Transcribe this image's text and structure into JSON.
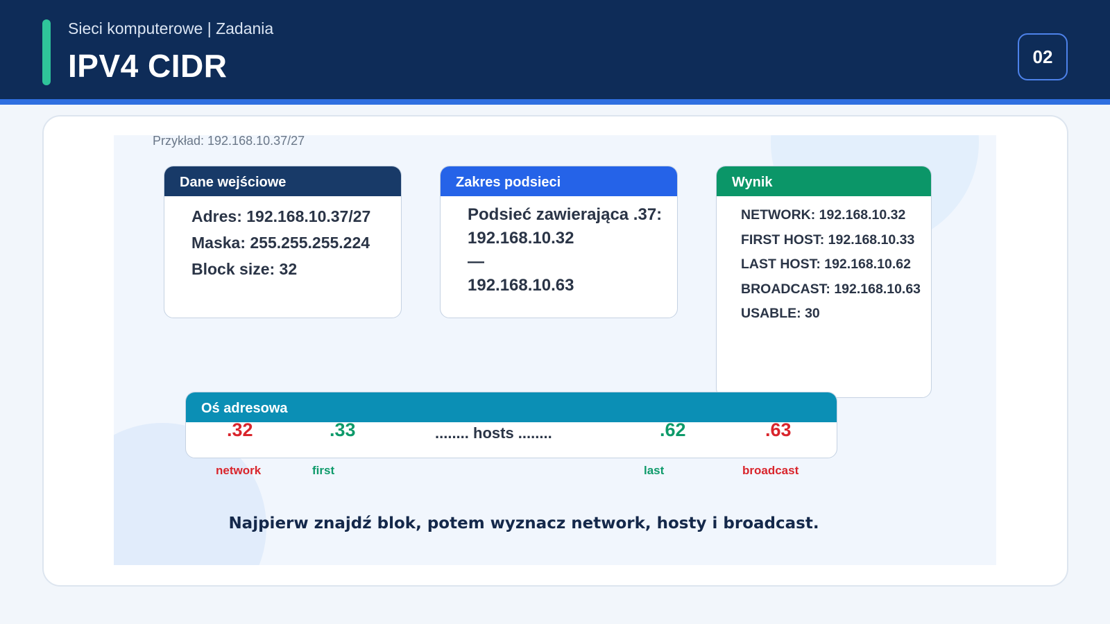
{
  "header": {
    "subtitle": "Sieci komputerowe | Zadania",
    "title": "IPV4 CIDR",
    "slide_number": "02"
  },
  "example": "Przykład: 192.168.10.37/27",
  "input_box": {
    "title": "Dane wejściowe",
    "lines": [
      "Adres: 192.168.10.37/27",
      "Maska: 255.255.255.224",
      "Block size: 32"
    ]
  },
  "range_box": {
    "title": "Zakres podsieci",
    "lines": [
      "Podsieć zawierająca .37:",
      "192.168.10.32",
      "—",
      "192.168.10.63"
    ]
  },
  "result_box": {
    "title": "Wynik",
    "lines": [
      "NETWORK: 192.168.10.32",
      "FIRST HOST: 192.168.10.33",
      "LAST HOST: 192.168.10.62",
      "BROADCAST: 192.168.10.63",
      "USABLE: 30"
    ]
  },
  "axis": {
    "title": "Oś adresowa",
    "values": [
      ".32",
      ".33",
      ".62",
      ".63"
    ],
    "labels": [
      "network",
      "first",
      "last",
      "broadcast"
    ],
    "hosts_text": "........ hosts ........"
  },
  "footer_note": "Najpierw znajdź blok, potem wyznacz network, hosty i broadcast.",
  "colors": {
    "header_bg": "#0e2c58",
    "accent": "#2fc49a",
    "input_head": "#183a68",
    "range_head": "#2563e8",
    "result_head": "#0b9668",
    "axis_head": "#0b8fb5",
    "network_red": "#d9252c",
    "host_green": "#0e9a6a"
  }
}
